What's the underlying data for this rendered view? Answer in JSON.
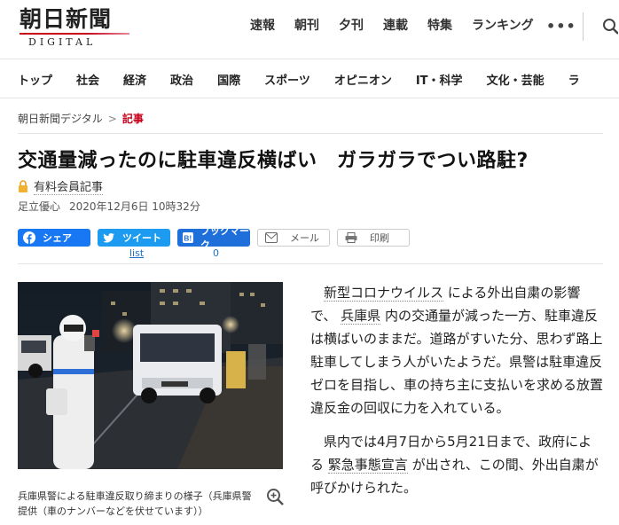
{
  "header": {
    "logo_jp": "朝日新聞",
    "logo_en": "DIGITAL",
    "top_nav": [
      "速報",
      "朝刊",
      "夕刊",
      "連載",
      "特集",
      "ランキング"
    ],
    "more": "•••"
  },
  "category_nav": [
    "トップ",
    "社会",
    "経済",
    "政治",
    "国際",
    "スポーツ",
    "オピニオン",
    "IT・科学",
    "文化・芸能",
    "ラ"
  ],
  "breadcrumb": {
    "home": "朝日新聞デジタル",
    "separator": ">",
    "current": "記事"
  },
  "article": {
    "title": "交通量減ったのに駐車違反横ばい　ガラガラでつい路駐?",
    "paid_label": "有料会員記事",
    "author": "足立優心",
    "date": "2020年12月6日 10時32分"
  },
  "share": {
    "facebook": "シェア",
    "twitter": "ツイート",
    "hatena": "ブックマーク",
    "mail": "メール",
    "print": "印刷",
    "twitter_count": "list",
    "hatena_count": "0"
  },
  "photo": {
    "caption": "兵庫県警による駐車違反取り締まりの様子（兵庫県警提供（車のナンバーなどを伏せています））"
  },
  "body": {
    "p1_a": "新型コロナウイルス",
    "p1_b": " による外出自粛の影響で、 ",
    "p1_c": "兵庫県",
    "p1_d": " 内の交通量が減った一方、駐車違反は横ばいのままだ。道路がすいた分、思わず路上駐車してしまう人がいたようだ。県警は駐車違反ゼロを目指し、車の持ち主に支払いを求める放置違反金の回収に力を入れている。",
    "p2_a": "県内では4月7日から5月21日まで、政府による ",
    "p2_b": "緊急事態宣言",
    "p2_c": " が出され、この間、外出自粛が呼びかけられた。"
  }
}
